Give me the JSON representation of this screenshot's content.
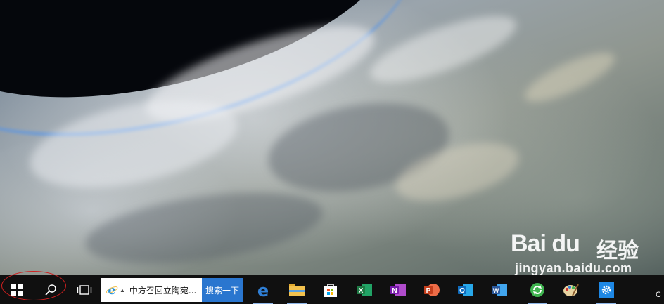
{
  "desktop": {
    "wallpaper": "earth-clouds-from-orbit",
    "watermark": {
      "brand": "Bai du",
      "brand_cn": "经验",
      "url": "jingyan.baidu.com"
    }
  },
  "taskbar": {
    "start_icon": "windows-logo-icon",
    "search_icon": "search-icon",
    "task_view_icon": "task-view-icon",
    "search_box": {
      "value": "中方召回立陶宛...",
      "engine_icon": "ie-icon",
      "go_label": "搜索一下"
    },
    "pinned_apps": [
      {
        "name": "edge",
        "icon": "edge-icon",
        "color": "#2f7fd6"
      },
      {
        "name": "file-explorer",
        "icon": "folder-icon",
        "color": "#f2c14e"
      },
      {
        "name": "store",
        "icon": "store-icon",
        "color": "#ffffff"
      },
      {
        "name": "excel",
        "icon": "excel-icon",
        "color": "#1f7a45"
      },
      {
        "name": "onenote",
        "icon": "onenote-icon",
        "color": "#8b2fa8"
      },
      {
        "name": "powerpoint",
        "icon": "powerpoint-icon",
        "color": "#d24726"
      },
      {
        "name": "outlook",
        "icon": "outlook-icon",
        "color": "#0f6cbd"
      },
      {
        "name": "word",
        "icon": "word-icon",
        "color": "#2b579a"
      },
      {
        "name": "sync-app",
        "icon": "sync-icon",
        "color": "#3fb34f"
      },
      {
        "name": "paint",
        "icon": "paint-icon",
        "color": "#e8d3a0"
      },
      {
        "name": "settings",
        "icon": "gear-icon",
        "color": "#1e88e5"
      }
    ],
    "tray_text": "C"
  },
  "colors": {
    "taskbar_bg": "#101010",
    "search_go_bg": "#2a76cf",
    "annotation": "#d02020"
  }
}
